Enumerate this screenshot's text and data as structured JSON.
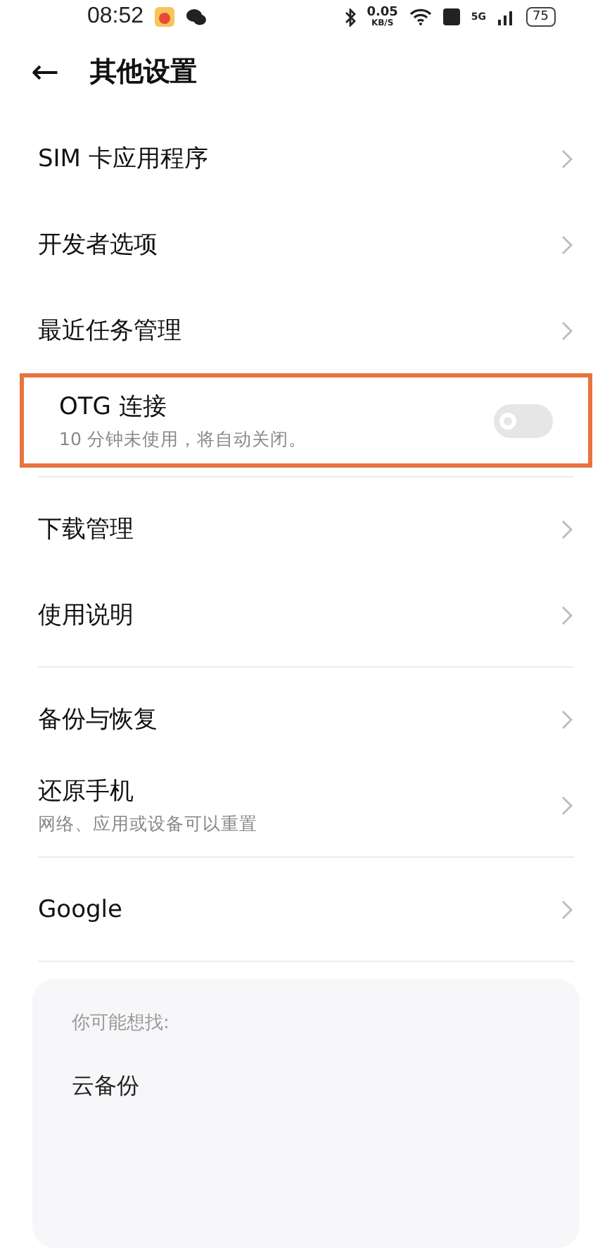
{
  "status_bar": {
    "time": "08:52",
    "speed_value": "0.05",
    "speed_unit": "KB/S",
    "network": "5G",
    "battery": "75"
  },
  "header": {
    "back": "←",
    "title": "其他设置"
  },
  "sections": [
    {
      "items": [
        {
          "kind": "link",
          "title": "SIM 卡应用程序",
          "highlighted": false
        },
        {
          "kind": "link",
          "title": "开发者选项",
          "highlighted": false
        },
        {
          "kind": "link",
          "title": "最近任务管理",
          "highlighted": false
        },
        {
          "kind": "switch",
          "title": "OTG 连接",
          "subtitle": "10 分钟未使用，将自动关闭。",
          "on": false,
          "highlighted": true
        }
      ]
    },
    {
      "items": [
        {
          "kind": "link",
          "title": "下载管理",
          "highlighted": false
        },
        {
          "kind": "link",
          "title": "使用说明",
          "highlighted": false
        }
      ]
    },
    {
      "items": [
        {
          "kind": "link",
          "title": "备份与恢复",
          "highlighted": false
        },
        {
          "kind": "link",
          "title": "还原手机",
          "subtitle": "网络、应用或设备可以重置",
          "highlighted": false
        }
      ]
    },
    {
      "items": [
        {
          "kind": "link",
          "title": "Google",
          "highlighted": false
        }
      ]
    }
  ],
  "suggestions": {
    "heading": "你可能想找:",
    "items": [
      "云备份"
    ]
  }
}
